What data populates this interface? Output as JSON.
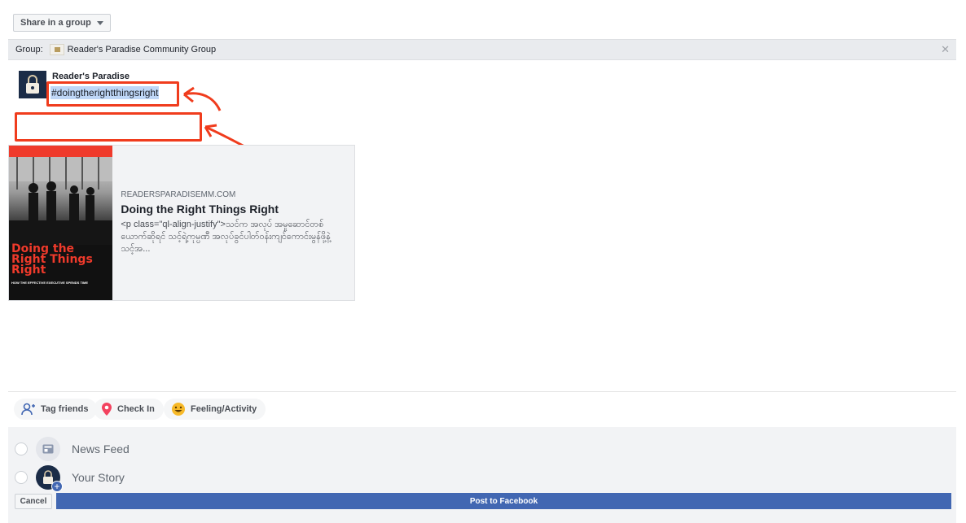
{
  "share": {
    "dropdown_label": "Share in a group"
  },
  "group": {
    "prefix": "Group:",
    "name": "Reader's Paradise Community Group"
  },
  "composer": {
    "page_name": "Reader's Paradise",
    "text": "#doingtherightthingsright"
  },
  "link_card": {
    "domain": "READERSPARADISEMM.COM",
    "title": "Doing the Right Things Right",
    "description": "<p class=\"ql-align-justify\">သင်က အလုပ် အမှုဆောင်တစ်ယောက်ဆိုရင် သင့်ရဲ့ကုမ္ပဏီ အလုပ်ခွင်ပါတ်ဝန်းကျင်ကောင်းမွန်ဖို့နဲ့ သင့်အ...",
    "image_title": "Doing the Right Things Right",
    "image_subtitle": "HOW THE EFFECTIVE EXECUTIVE SPENDS TIME"
  },
  "actions": {
    "tag": "Tag friends",
    "checkin": "Check In",
    "feeling": "Feeling/Activity"
  },
  "audience": {
    "news_feed": "News Feed",
    "your_story": "Your Story"
  },
  "buttons": {
    "cancel": "Cancel",
    "post": "Post to Facebook"
  },
  "colors": {
    "brand": "#4267b2",
    "annotation": "#f03c1d",
    "highlight": "#bfd7f7"
  }
}
